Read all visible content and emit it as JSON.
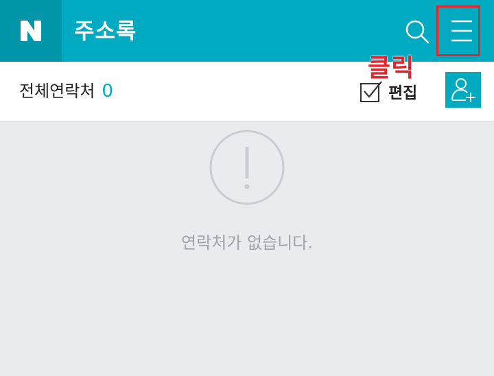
{
  "header": {
    "logo_text": "N",
    "title": "주소록",
    "search_icon": "search-icon",
    "menu_icon": "hamburger-menu-icon",
    "background_color": "#00aac0",
    "logo_background_color": "#0095a8"
  },
  "annotation": {
    "click_label": "클릭",
    "highlight_color": "#e3262e"
  },
  "subbar": {
    "all_contacts_label": "전체연락처",
    "contact_count": "0",
    "edit_label": "편집",
    "edit_icon": "checkbox-check-icon",
    "add_contact_icon": "add-person-icon",
    "accent_color": "#00aac0"
  },
  "empty_state": {
    "icon": "exclamation-circle-icon",
    "message": "연락처가 없습니다."
  }
}
